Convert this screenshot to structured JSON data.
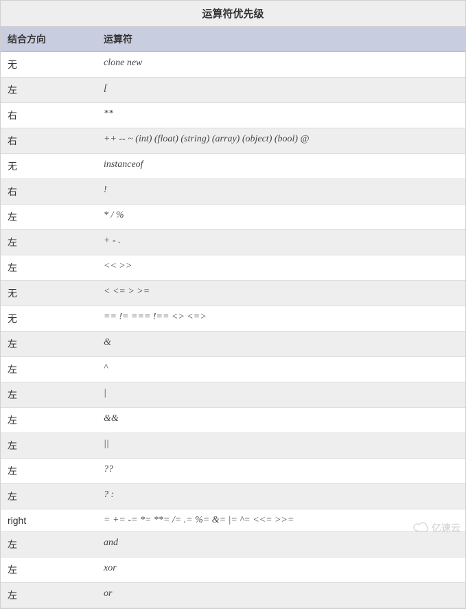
{
  "table": {
    "title": "运算符优先级",
    "headers": {
      "associativity": "结合方向",
      "operators": "运算符"
    },
    "rows": [
      {
        "assoc": "无",
        "op": "clone new"
      },
      {
        "assoc": "左",
        "op": "["
      },
      {
        "assoc": "右",
        "op": "**"
      },
      {
        "assoc": "右",
        "op": "++ -- ~ (int) (float) (string) (array) (object) (bool) @"
      },
      {
        "assoc": "无",
        "op": "instanceof"
      },
      {
        "assoc": "右",
        "op": "!"
      },
      {
        "assoc": "左",
        "op": "* / %"
      },
      {
        "assoc": "左",
        "op": "+ - ."
      },
      {
        "assoc": "左",
        "op": "<< >>"
      },
      {
        "assoc": "无",
        "op": "< <= > >="
      },
      {
        "assoc": "无",
        "op": "== != === !== <> <=>"
      },
      {
        "assoc": "左",
        "op": "&"
      },
      {
        "assoc": "左",
        "op": "^"
      },
      {
        "assoc": "左",
        "op": "|"
      },
      {
        "assoc": "左",
        "op": "&&"
      },
      {
        "assoc": "左",
        "op": "||"
      },
      {
        "assoc": "左",
        "op": "??"
      },
      {
        "assoc": "左",
        "op": "? :"
      },
      {
        "assoc": "right",
        "op": "= += -= *= **= /= .= %= &= |= ^= <<= >>="
      },
      {
        "assoc": "左",
        "op": "and"
      },
      {
        "assoc": "左",
        "op": "xor"
      },
      {
        "assoc": "左",
        "op": "or"
      }
    ]
  },
  "watermark": {
    "text": "亿速云"
  }
}
